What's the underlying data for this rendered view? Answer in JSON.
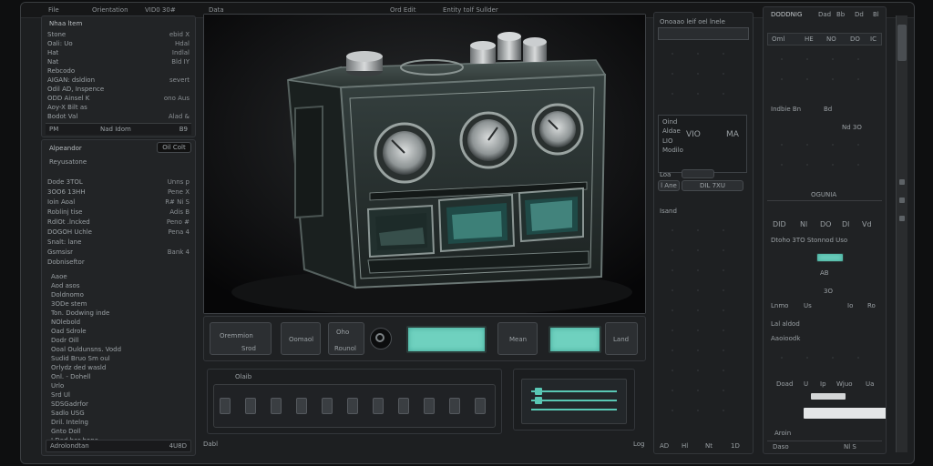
{
  "menubar": [
    "File",
    "Orientation",
    "VID0 30#",
    "Data",
    "Ord Edit",
    "Entity tolf Sullder"
  ],
  "left_panel": {
    "header": "Nhaa ltem",
    "rows": [
      {
        "l": "Stone",
        "r": "ebid X"
      },
      {
        "l": "Oali: Uo",
        "r": "Hdal"
      },
      {
        "l": "Hat",
        "r": "Indlal"
      },
      {
        "l": "Nat",
        "r": "Bld IY"
      },
      {
        "l": "Rebcodo",
        "r": ""
      },
      {
        "l": "AIGAN: dsldion",
        "r": "severt"
      },
      {
        "l": "Odil AD, Inspence",
        "r": ""
      },
      {
        "l": "ODD Ainsel K",
        "r": "ono Aus"
      },
      {
        "l": "Aoy-X Bilt as",
        "r": ""
      },
      {
        "l": "Bodot Val",
        "r": "Alad &"
      }
    ],
    "footer_l": "PM",
    "footer_m": "Nad Idom",
    "footer_r": "B9"
  },
  "left_panel2": {
    "title": "Alpeandor",
    "badge": "Oil Colt",
    "sub": "Reyusatone",
    "rows": [
      {
        "l": "Dode 3TOL",
        "r": "Unns  p"
      },
      {
        "l": "3OO6 13HH",
        "r": "Pene  X"
      },
      {
        "l": "Ioin Aoal",
        "r": "R#  Ni  S"
      },
      {
        "l": "Roblinj tise",
        "r": "Adis  B"
      },
      {
        "l": "RdlOt .lncked",
        "r": "Peno  #"
      },
      {
        "l": "DOGOH Uchle",
        "r": "Pena  4"
      },
      {
        "l": "Snalt: lane",
        "r": ""
      },
      {
        "l": "Gsmsisr",
        "r": "Bank  4"
      },
      {
        "l": "Dobniseftor",
        "r": ""
      }
    ],
    "list": [
      "Aaoe",
      "Aod asos",
      "Doldnomo",
      "3ODe stem",
      "Ton. Dodwing inde",
      "NOlebold",
      "Oad Sdrole",
      "Dodr Oill",
      "Ooal Ouldunsns. Vodd",
      "Sudid Bruo Sm oul",
      "Orlydz ded wasld",
      "Onl. - Dohell",
      "Urlo",
      "Srd Ul",
      "SDSGadrfor",
      "Sadlo USG",
      "Dril. Intelng",
      "Gnto Doll",
      "I Ded bor bone"
    ],
    "footer_l": "Adrolondtan",
    "footer_r": "4U8D"
  },
  "viewport": {
    "title": "Ord Edit"
  },
  "bottom_controls": {
    "b1_top": "Oremmion",
    "b1_bot": "Srod",
    "b2": "Oomaol",
    "b3_top": "Oho",
    "b3_bot": "Rounol",
    "b5": "Mean",
    "b6": "Land",
    "seq_title": "Olaib",
    "status_l": "Dabl",
    "status_r": "Log"
  },
  "mid_panel": {
    "header": "Onoaao leif oel lnele",
    "box_a": "Oind",
    "box_b": "Aldae",
    "box_c": "Modilo",
    "vio": "VIO",
    "ma": "MA",
    "sub": "LIO",
    "tag1": "Loa",
    "tag2": "l Ane",
    "tag3": "DIL 7XU",
    "note": "Isand",
    "footer": [
      "AD",
      "Hl",
      "Nt",
      "1D"
    ]
  },
  "right_panel": {
    "title": "DODDNIG",
    "top_items": [
      "Dad",
      "Bb",
      "Dd",
      "Bl"
    ],
    "tabs": [
      "Oml",
      "HE",
      "NO",
      "DO",
      "IC"
    ],
    "r1": "Indbie Bn",
    "r1b": "Bd",
    "r1c": "Nd 3O",
    "sect": "OGUNIA",
    "opts": [
      "DID",
      "Nl",
      "DO",
      "Dl",
      "Vd"
    ],
    "r2": "Dtoho 3TO Stonnod Uso",
    "ab": "AB",
    "rowx": [
      "Lnmo",
      "Us",
      "3O",
      "Io",
      "Ro"
    ],
    "r3": "Lal aldod",
    "r4": "Aaoioodk",
    "r5": "Doad",
    "r6": [
      "U",
      "Ip",
      "Wjuo",
      "Ua"
    ],
    "r7": "Aroin",
    "r8": "Daso",
    "r8b": "Nl S"
  }
}
